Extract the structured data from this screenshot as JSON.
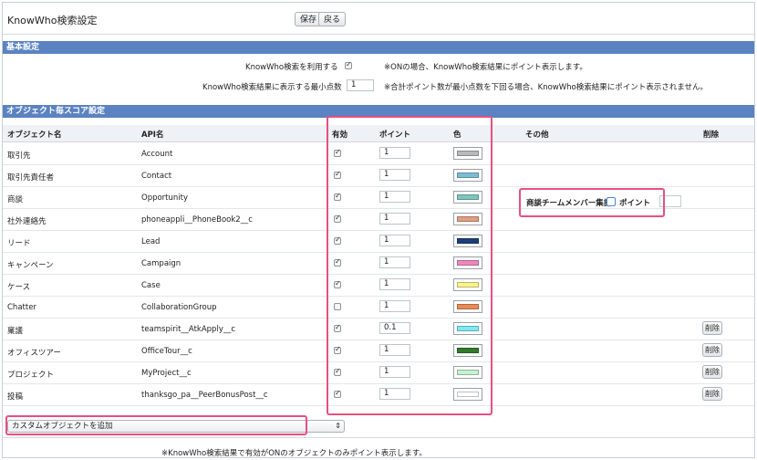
{
  "header": {
    "title": "KnowWho検索設定",
    "save_label": "保存",
    "back_label": "戻る"
  },
  "basic": {
    "section_title": "基本設定",
    "use_label": "KnowWho検索を利用する",
    "use_checked": true,
    "use_note": "※ONの場合、KnowWho検索結果にポイント表示します。",
    "min_label": "KnowWho検索結果に表示する最小点数",
    "min_value": "1",
    "min_note": "※合計ポイント数が最小点数を下回る場合、KnowWho検索結果にポイント表示されません。"
  },
  "objects": {
    "section_title": "オブジェクト毎スコア設定",
    "columns": {
      "name": "オブジェクト名",
      "api": "API名",
      "enabled": "有効",
      "points": "ポイント",
      "color": "色",
      "other": "その他",
      "delete": "削除"
    },
    "rows": [
      {
        "name": "取引先",
        "api": "Account",
        "enabled": true,
        "points": "1",
        "color": "#b9b9b9",
        "deletable": false
      },
      {
        "name": "取引先責任者",
        "api": "Contact",
        "enabled": true,
        "points": "1",
        "color": "#7cbcd6",
        "deletable": false
      },
      {
        "name": "商談",
        "api": "Opportunity",
        "enabled": true,
        "points": "1",
        "color": "#7ec7bf",
        "deletable": false
      },
      {
        "name": "社外連絡先",
        "api": "phoneappli__PhoneBook2__c",
        "enabled": true,
        "points": "1",
        "color": "#df9f84",
        "deletable": false
      },
      {
        "name": "リード",
        "api": "Lead",
        "enabled": true,
        "points": "1",
        "color": "#1d3f78",
        "deletable": false
      },
      {
        "name": "キャンペーン",
        "api": "Campaign",
        "enabled": true,
        "points": "1",
        "color": "#ef87bd",
        "deletable": false
      },
      {
        "name": "ケース",
        "api": "Case",
        "enabled": true,
        "points": "1",
        "color": "#fbf48a",
        "deletable": false
      },
      {
        "name": "Chatter",
        "api": "CollaborationGroup",
        "enabled": false,
        "points": "1",
        "color": "#e98a55",
        "deletable": false
      },
      {
        "name": "稟議",
        "api": "teamspirit__AtkApply__c",
        "enabled": true,
        "points": "0.1",
        "color": "#7fe8f3",
        "deletable": true
      },
      {
        "name": "オフィスツアー",
        "api": "OfficeTour__c",
        "enabled": true,
        "points": "1",
        "color": "#2f7a28",
        "deletable": true
      },
      {
        "name": "プロジェクト",
        "api": "MyProject__c",
        "enabled": true,
        "points": "1",
        "color": "#c4f2cf",
        "deletable": true
      },
      {
        "name": "投稿",
        "api": "thanksgo_pa__PeerBonusPost__c",
        "enabled": true,
        "points": "1",
        "color": "#ffffff",
        "deletable": true
      }
    ],
    "delete_label": "削除",
    "opportunity_team": {
      "label": "商談チームメンバー集計",
      "points_label": "ポイント",
      "checked": false,
      "value": ""
    },
    "add_custom_label": "カスタムオブジェクトを追加"
  },
  "footer_note": "※KnowWho検索結果で有効がONのオブジェクトのみポイント表示します。",
  "colors": {
    "section_header": "#5b83c2",
    "highlight": "#e8507f"
  }
}
